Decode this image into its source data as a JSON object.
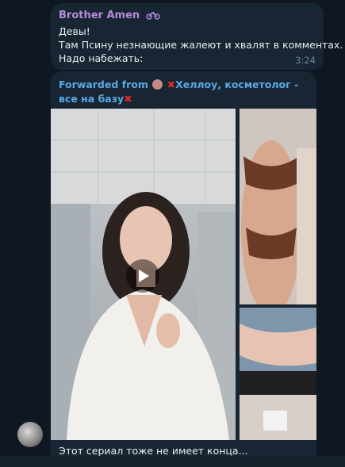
{
  "message1": {
    "sender": "Brother Amen",
    "sender_icon": "bicycle-icon",
    "lines": [
      "Девы!",
      "Там Псину незнающие жалеют и хвалят в комментах.",
      "Надо набежать:"
    ],
    "time": "3:24"
  },
  "message2": {
    "forwarded_prefix": "Forwarded from",
    "forwarded_channel": "Хеллоу, косметолог - все на базу",
    "caption": "Этот сериал тоже не имеет конца..."
  },
  "colors": {
    "background": "#0f1822",
    "bubble": "#182533",
    "sender": "#b48bd9",
    "forward": "#5aa9e6",
    "cross": "#e0262b"
  }
}
